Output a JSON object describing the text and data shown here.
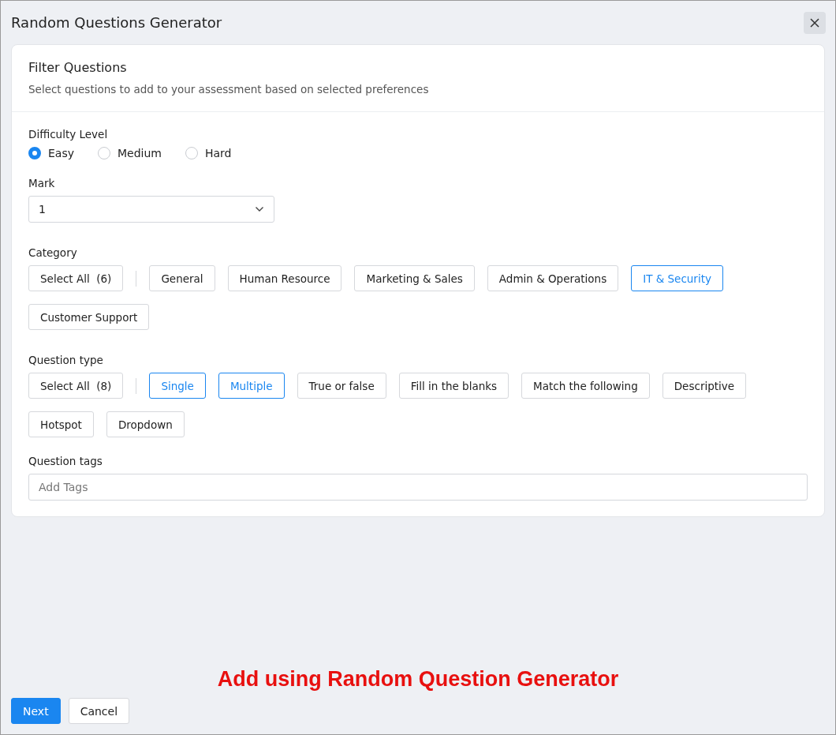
{
  "window": {
    "title": "Random Questions Generator"
  },
  "card": {
    "title": "Filter Questions",
    "subtitle": "Select questions to add to your assessment based on selected preferences"
  },
  "difficulty": {
    "label": "Difficulty Level",
    "options": [
      {
        "label": "Easy",
        "selected": true
      },
      {
        "label": "Medium",
        "selected": false
      },
      {
        "label": "Hard",
        "selected": false
      }
    ]
  },
  "mark": {
    "label": "Mark",
    "value": "1"
  },
  "category": {
    "label": "Category",
    "chips": [
      {
        "label": "Select All  (6)",
        "kind": "select_all",
        "selected": false
      },
      {
        "label": "General",
        "kind": "option",
        "selected": false
      },
      {
        "label": "Human Resource",
        "kind": "option",
        "selected": false
      },
      {
        "label": "Marketing & Sales",
        "kind": "option",
        "selected": false
      },
      {
        "label": "Admin & Operations",
        "kind": "option",
        "selected": false
      },
      {
        "label": "IT & Security",
        "kind": "option",
        "selected": true
      },
      {
        "label": "Customer Support",
        "kind": "option",
        "selected": false
      }
    ]
  },
  "question_type": {
    "label": "Question type",
    "chips": [
      {
        "label": "Select All  (8)",
        "kind": "select_all",
        "selected": false
      },
      {
        "label": "Single",
        "kind": "option",
        "selected": true
      },
      {
        "label": "Multiple",
        "kind": "option",
        "selected": true
      },
      {
        "label": "True or false",
        "kind": "option",
        "selected": false
      },
      {
        "label": "Fill in the blanks",
        "kind": "option",
        "selected": false
      },
      {
        "label": "Match the following",
        "kind": "option",
        "selected": false
      },
      {
        "label": "Descriptive",
        "kind": "option",
        "selected": false
      },
      {
        "label": "Hotspot",
        "kind": "option",
        "selected": false
      },
      {
        "label": "Dropdown",
        "kind": "option",
        "selected": false
      }
    ]
  },
  "tags": {
    "label": "Question tags",
    "placeholder": "Add Tags"
  },
  "annotation": "Add using Random Question Generator",
  "buttons": [
    {
      "label": "Next",
      "kind": "primary"
    },
    {
      "label": "Cancel",
      "kind": "secondary"
    }
  ]
}
